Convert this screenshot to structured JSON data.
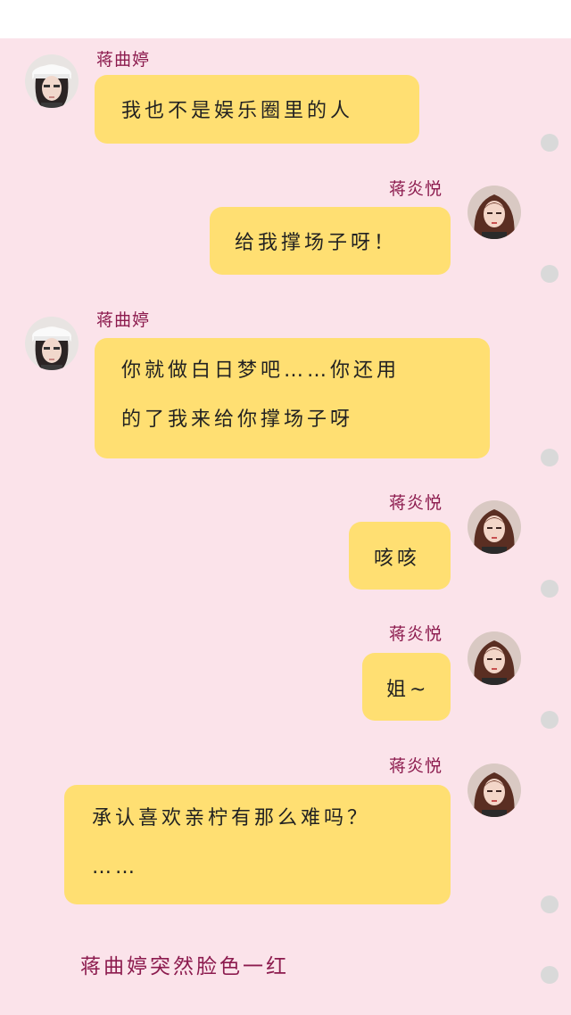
{
  "colors": {
    "background": "#fbe3ea",
    "bubble": "#ffdf72",
    "name_text": "#8c1b4e",
    "dot": "#d9d9d9"
  },
  "characters": {
    "left": {
      "name": "蒋曲婷",
      "avatar_icon": "avatar-woman-white-cap"
    },
    "right": {
      "name": "蒋炎悦",
      "avatar_icon": "avatar-woman-long-hair"
    }
  },
  "messages": [
    {
      "side": "left",
      "name": "蒋曲婷",
      "lines": [
        "我也不是娱乐圈里的人"
      ]
    },
    {
      "side": "right",
      "name": "蒋炎悦",
      "lines": [
        "给我撑场子呀！"
      ]
    },
    {
      "side": "left",
      "name": "蒋曲婷",
      "lines": [
        "你就做白日梦吧……你还用",
        "的了我来给你撑场子呀"
      ]
    },
    {
      "side": "right",
      "name": "蒋炎悦",
      "lines": [
        "咳咳"
      ]
    },
    {
      "side": "right",
      "name": "蒋炎悦",
      "lines": [
        "姐~"
      ]
    },
    {
      "side": "right",
      "name": "蒋炎悦",
      "lines": [
        "承认喜欢亲柠有那么难吗？",
        "……"
      ]
    }
  ],
  "narration": "蒋曲婷突然脸色一红"
}
